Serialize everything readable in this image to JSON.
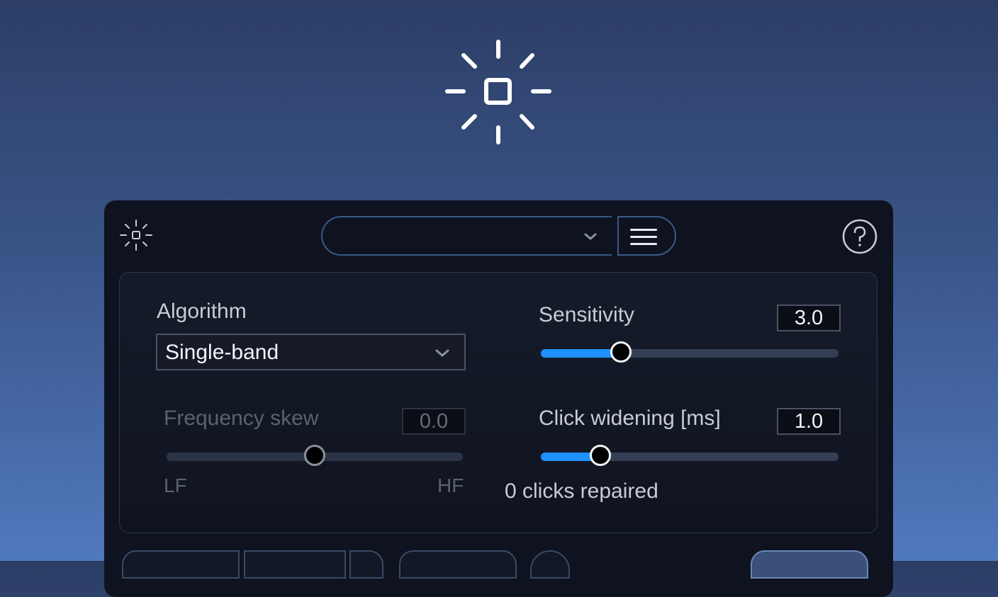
{
  "app": {
    "hero_icon": "burst-square-icon",
    "logo_icon": "burst-square-icon",
    "preset": {
      "value": "",
      "chevron_icon": "chevron-down-icon"
    },
    "menu_icon": "hamburger-menu-icon",
    "help_icon": "question-circle-icon"
  },
  "module": {
    "algorithm": {
      "label": "Algorithm",
      "selected": "Single-band"
    },
    "frequency_skew": {
      "label": "Frequency skew",
      "value": "0.0",
      "min_label": "LF",
      "max_label": "HF",
      "level_fraction": 0.5,
      "enabled": false
    },
    "sensitivity": {
      "label": "Sensitivity",
      "value": "3.0",
      "level_fraction": 0.27
    },
    "click_widening": {
      "label": "Click widening [ms]",
      "value": "1.0",
      "level_fraction": 0.2
    },
    "status": "0 clicks repaired"
  },
  "colors": {
    "accent": "#1e90ff",
    "panel_bg": "#0f1320",
    "border": "#3a5a8a"
  }
}
